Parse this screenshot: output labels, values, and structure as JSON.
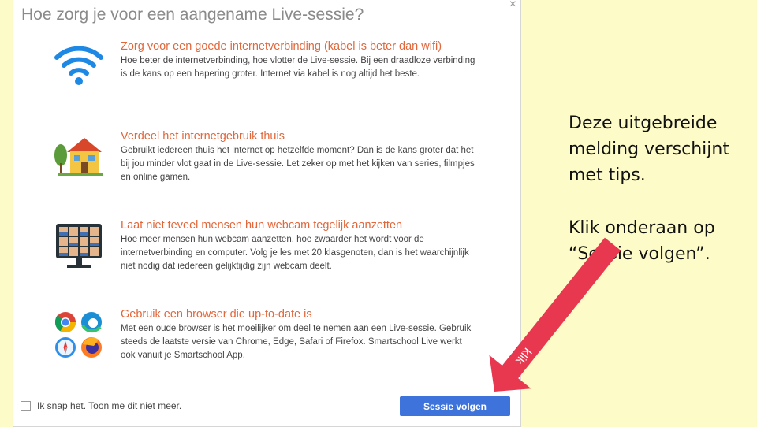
{
  "dialog": {
    "title": "Hoe zorg je voor een aangename Live-sessie?",
    "close": "×",
    "tips": [
      {
        "icon": "wifi-icon",
        "heading": "Zorg voor een goede internetverbinding (kabel is beter dan wifi)",
        "text": "Hoe beter de internetverbinding, hoe vlotter de Live-sessie. Bij een draadloze verbinding is de kans op een hapering groter. Internet via kabel is nog altijd het beste."
      },
      {
        "icon": "house-icon",
        "heading": "Verdeel het internetgebruik thuis",
        "text": "Gebruikt iedereen thuis het internet op hetzelfde moment? Dan is de kans groter dat het bij jou minder vlot gaat in de Live-sessie. Let zeker op met het kijken van series, filmpjes en online gamen."
      },
      {
        "icon": "webcam-grid-icon",
        "heading": "Laat niet teveel mensen hun webcam tegelijk aanzetten",
        "text": "Hoe meer mensen hun webcam aanzetten, hoe zwaarder het wordt voor de internetverbinding en computer. Volg je les met 20 klasgenoten, dan is het waarchijnlijk niet nodig dat iedereen gelijktijdig zijn webcam deelt."
      },
      {
        "icon": "browsers-icon",
        "heading": "Gebruik een browser die up-to-date is",
        "text": "Met een oude browser is het moeilijker om deel te nemen aan een Live-sessie. Gebruik steeds de laatste versie van Chrome, Edge, Safari of Firefox. Smartschool Live werkt ook vanuit je Smartschool App."
      }
    ],
    "checkbox_label": "Ik snap het. Toon me dit niet meer.",
    "primary_button": "Sessie volgen"
  },
  "annotations": {
    "note1": "Deze uitgebreide melding verschijnt met tips.",
    "note2": "Klik onderaan op “Sessie volgen”.",
    "arrow_label": "klik",
    "arrow_color": "#e8384f"
  }
}
